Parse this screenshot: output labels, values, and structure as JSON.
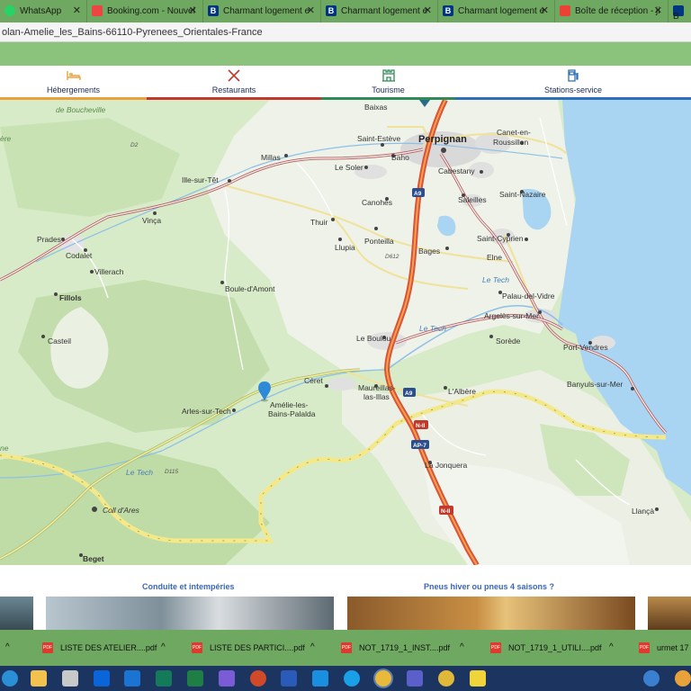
{
  "browser": {
    "tabs": [
      {
        "label": "WhatsApp",
        "icon": "whatsapp-icon"
      },
      {
        "label": "Booking.com - Nouvel",
        "icon": "gmail-icon"
      },
      {
        "label": "Charmant logement e",
        "icon": "booking-icon"
      },
      {
        "label": "Charmant logement e",
        "icon": "booking-icon"
      },
      {
        "label": "Charmant logement e",
        "icon": "booking-icon"
      },
      {
        "label": "Boîte de réception - ji",
        "icon": "gmail-icon"
      },
      {
        "label": "",
        "icon": "booking-icon"
      }
    ],
    "booking_glyph": "B",
    "close_glyph": "✕",
    "address": "olan-Amelie_les_Bains-66110-Pyrenees_Orientales-France"
  },
  "nav": {
    "items": [
      {
        "label": "Hébergements",
        "icon": "bed-icon",
        "stripe": "#e9a23b"
      },
      {
        "label": "Restaurants",
        "icon": "cutlery-icon",
        "stripe": "#c0392b"
      },
      {
        "label": "Tourisme",
        "icon": "landmark-icon",
        "stripe": "#2e8b57"
      },
      {
        "label": "Stations-service",
        "icon": "fuel-icon",
        "stripe": "#2f6fb8"
      }
    ]
  },
  "map": {
    "labels": {
      "de_boucheville": "de Boucheville",
      "baixas": "Baixas",
      "perpignan": "Perpignan",
      "canet": "Canet-en-",
      "roussillon": "Roussillon",
      "saint_esteve": "Saint-Estève",
      "millas": "Millas",
      "le_soler": "Le Soler",
      "baho": "Baho",
      "cabestany": "Cabestany",
      "ille_sur_tet": "Ille-sur-Têt",
      "canohes": "Canohès",
      "saleilles": "Saleilles",
      "saint_nazaire": "Saint-Nazaire",
      "vinca": "Vinça",
      "thuir": "Thuir",
      "llupia": "Llupia",
      "ponteilla": "Ponteilla",
      "bages": "Bages",
      "saint_cyprien": "Saint-Cyprien",
      "elne": "Elne",
      "prades": "Prades",
      "codalet": "Codalet",
      "villerach": "Villerach",
      "fillols": "Fillols",
      "boule_d_amont": "Boule-d'Amont",
      "palau": "Palau-del-Vidre",
      "argeles": "Argelès-sur-Mer",
      "le_tech_1": "Le Tech",
      "le_tech_2": "Le Tech",
      "le_tech_3": "Le Tech",
      "casteil": "Casteil",
      "le_boulou": "Le Boulou",
      "sorede": "Sorède",
      "port_vendres": "Port-Vendres",
      "ceret": "Céret",
      "maureillas_1": "Maureillas-",
      "maureillas_2": "las-Illas",
      "l_albere": "L'Albère",
      "banyuls": "Banyuls-sur-Mer",
      "arles_sur_tech": "Arles-sur-Tech",
      "amelie_1": "Amélie-les-",
      "amelie_2": "Bains-Palalda",
      "la_jonquera": "La Jonquera",
      "coll_d_ares": "Coll d'Ares",
      "llanca": "Llançà",
      "beget": "Beget",
      "road_a9_1": "A9",
      "road_a9_2": "A9",
      "road_d612": "D612",
      "road_d115": "D115",
      "road_n2_1": "N-II",
      "road_ap7": "AP-7",
      "road_n2_2": "N-II",
      "road_d2": "D2",
      "edge_ere": "ère",
      "edge_ne": "ne"
    }
  },
  "below": {
    "left_title": "Conduite et intempéries",
    "right_title": "Pneus hiver ou pneus 4 saisons ?"
  },
  "downloads": [
    {
      "name": "LISTE DES ATELIER....pdf"
    },
    {
      "name": "LISTE DES PARTICI....pdf"
    },
    {
      "name": "NOT_1719_1_INST....pdf"
    },
    {
      "name": "NOT_1719_1_UTILI....pdf"
    },
    {
      "name": "urmet 17"
    }
  ],
  "download_badge": "PDF",
  "expand_glyph": "^"
}
